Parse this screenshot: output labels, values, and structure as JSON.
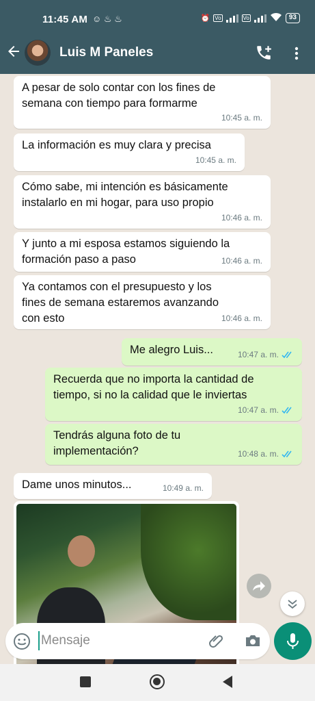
{
  "status_bar": {
    "time": "11:45 AM",
    "notification_icons": "☺ ♨ ♨",
    "battery": "93"
  },
  "header": {
    "contact_name": "Luis M Paneles",
    "icons": {
      "back": "arrow-left-icon",
      "call": "add-call-icon",
      "menu": "more-vert-icon"
    }
  },
  "messages": [
    {
      "dir": "in",
      "text": "A pesar de solo contar con los fines de\nsemana con tiempo para formarme",
      "time": "10:45 a. m."
    },
    {
      "dir": "in",
      "text": "La información es muy clara y precisa",
      "time": "10:45 a. m."
    },
    {
      "dir": "in",
      "text": "Cómo sabe, mi intención es básicamente\ninstalarlo en mi hogar, para uso propio",
      "time": "10:46 a. m."
    },
    {
      "dir": "in",
      "text": "Y junto a mi esposa estamos siguiendo la\nformación paso a paso",
      "time": "10:46 a. m."
    },
    {
      "dir": "in",
      "text": "Ya contamos con el presupuesto y los\nfines de semana estaremos avanzando\ncon esto",
      "time": "10:46 a. m."
    },
    {
      "dir": "out",
      "text": "Me alegro Luis...",
      "time": "10:47 a. m.",
      "read": true
    },
    {
      "dir": "out",
      "text": "Recuerda que no importa la cantidad de\ntiempo, si no la calidad que le inviertas",
      "time": "10:47 a. m.",
      "read": true
    },
    {
      "dir": "out",
      "text": "Tendrás alguna foto de tu\nimplementación?",
      "time": "10:48 a. m.",
      "read": true
    },
    {
      "dir": "in",
      "text": "Dame unos minutos...",
      "time": "10:49 a. m."
    }
  ],
  "composer": {
    "placeholder": "Mensaje"
  },
  "colors": {
    "header": "#3b5a64",
    "chat_bg": "#ece5dd",
    "outgoing": "#dcf8c6",
    "incoming": "#ffffff",
    "mic": "#0a8f77",
    "tick_read": "#34b7f1"
  }
}
